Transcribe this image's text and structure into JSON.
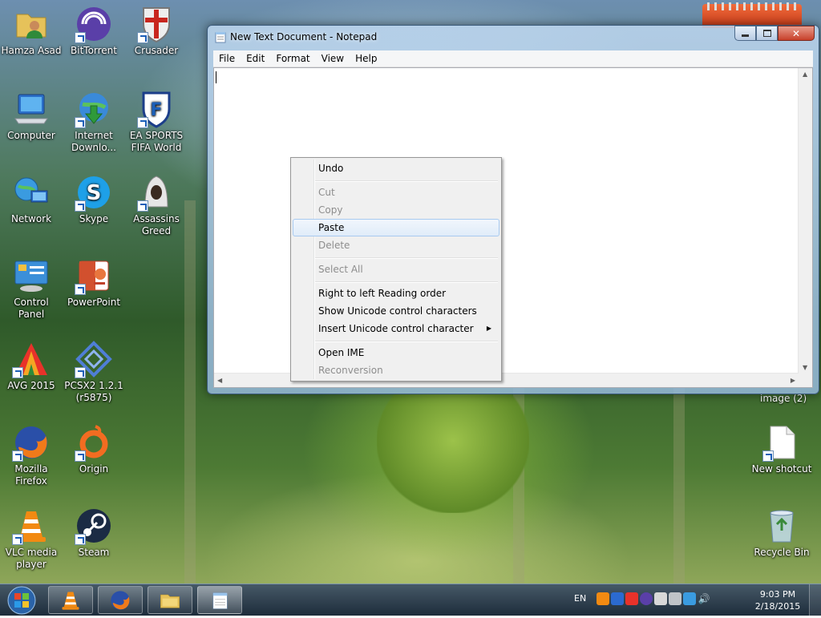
{
  "desktop_icons": [
    {
      "id": "hamza",
      "label": "Hamza Asad",
      "icon": "user-folder-icon",
      "shortcut": false
    },
    {
      "id": "bittorrent",
      "label": "BitTorrent",
      "icon": "bittorrent-icon",
      "shortcut": true
    },
    {
      "id": "crusader",
      "label": "Crusader",
      "icon": "crusader-shield-icon",
      "shortcut": true
    },
    {
      "id": "computer",
      "label": "Computer",
      "icon": "computer-icon",
      "shortcut": false
    },
    {
      "id": "idm",
      "label": "Internet Downlo...",
      "icon": "internet-download-manager-icon",
      "shortcut": true
    },
    {
      "id": "fifa",
      "label": "EA SPORTS FIFA World",
      "icon": "fifa-shield-icon",
      "shortcut": true
    },
    {
      "id": "network",
      "label": "Network",
      "icon": "network-icon",
      "shortcut": false
    },
    {
      "id": "skype",
      "label": "Skype",
      "icon": "skype-icon",
      "shortcut": true
    },
    {
      "id": "assassins",
      "label": "Assassins Greed",
      "icon": "assassins-creed-icon",
      "shortcut": true
    },
    {
      "id": "control",
      "label": "Control Panel",
      "icon": "control-panel-icon",
      "shortcut": false
    },
    {
      "id": "powerpoint",
      "label": "PowerPoint",
      "icon": "powerpoint-icon",
      "shortcut": true
    },
    {
      "id": "avg",
      "label": "AVG 2015",
      "icon": "avg-icon",
      "shortcut": true
    },
    {
      "id": "pcsx2",
      "label": "PCSX2 1.2.1 (r5875)",
      "icon": "pcsx2-icon",
      "shortcut": true
    },
    {
      "id": "firefox",
      "label": "Mozilla Firefox",
      "icon": "firefox-icon",
      "shortcut": true
    },
    {
      "id": "origin",
      "label": "Origin",
      "icon": "origin-icon",
      "shortcut": true
    },
    {
      "id": "vlc",
      "label": "VLC media player",
      "icon": "vlc-icon",
      "shortcut": true
    },
    {
      "id": "steam",
      "label": "Steam",
      "icon": "steam-icon",
      "shortcut": true
    },
    {
      "id": "newshortcut",
      "label": "New shotcut",
      "icon": "blank-document-icon",
      "shortcut": true
    },
    {
      "id": "recycle",
      "label": "Recycle Bin",
      "icon": "recycle-bin-icon",
      "shortcut": false
    }
  ],
  "partial_label": "image (2)",
  "notepad": {
    "title": "New Text Document - Notepad",
    "menu": [
      "File",
      "Edit",
      "Format",
      "View",
      "Help"
    ],
    "close_glyph": "✕",
    "content": ""
  },
  "context_menu": {
    "undo": "Undo",
    "cut": "Cut",
    "copy": "Copy",
    "paste": "Paste",
    "delete": "Delete",
    "select_all": "Select All",
    "rtl": "Right to left Reading order",
    "show_unicode": "Show Unicode control characters",
    "insert_unicode": "Insert Unicode control character",
    "open_ime": "Open IME",
    "reconversion": "Reconversion"
  },
  "taskbar": {
    "language": "EN",
    "time": "9:03 PM",
    "date": "2/18/2015",
    "pinned": [
      "vlc-icon",
      "firefox-icon",
      "explorer-folder-icon",
      "notepad-icon"
    ],
    "active": "notepad-icon"
  },
  "colors": {
    "accent": "#1c5fb8",
    "close_button": "#c7402a",
    "menu_hover_border": "#a8caf0",
    "disabled_text": "#8d8d8d"
  }
}
